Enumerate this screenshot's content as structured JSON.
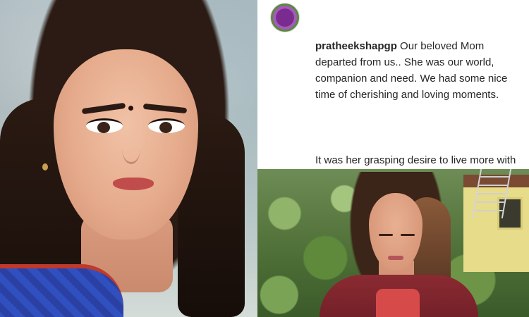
{
  "caption": {
    "username": "pratheekshapgp",
    "paragraph1": "Our beloved Mom departed from us.. She was our world, companion and need. We had some nice time of cherishing and loving moments.",
    "paragraph2": "It was her grasping desire to live more with us, but she couldn't bear more pain and finally stopped her breath while we were on way to hospital."
  },
  "colors": {
    "caption_text": "#262626",
    "background": "#ffffff"
  }
}
